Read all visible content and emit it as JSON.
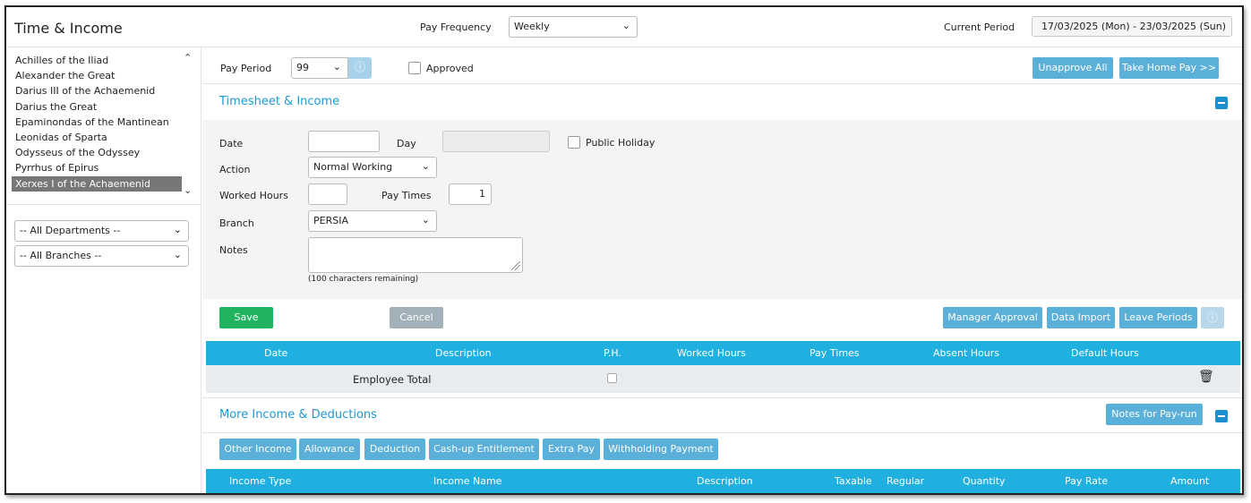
{
  "header": {
    "title": "Time & Income",
    "pay_frequency_label": "Pay Frequency",
    "pay_frequency_value": "Weekly",
    "current_period_label": "Current Period",
    "current_period_value": "17/03/2025 (Mon) - 23/03/2025 (Sun)"
  },
  "sidebar": {
    "employees": [
      "Achilles of the Iliad",
      "Alexander the Great",
      "Darius III of the Achaemenid",
      "Darius the Great",
      "Epaminondas of the Mantinean",
      "Leonidas of Sparta",
      "Odysseus of the Odyssey",
      "Pyrrhus of Epirus",
      "Xerxes I of the Achaemenid"
    ],
    "selected_index": 8,
    "department_filter": "-- All Departments --",
    "branch_filter": "-- All Branches --"
  },
  "payperiod": {
    "label": "Pay Period",
    "value": "99",
    "approved_label": "Approved",
    "unapprove_all": "Unapprove All",
    "take_home_pay": "Take Home Pay >>"
  },
  "timesheet": {
    "title": "Timesheet & Income",
    "date_label": "Date",
    "day_label": "Day",
    "public_holiday_label": "Public Holiday",
    "action_label": "Action",
    "action_value": "Normal Working",
    "worked_hours_label": "Worked Hours",
    "pay_times_label": "Pay Times",
    "pay_times_value": "1",
    "branch_label": "Branch",
    "branch_value": "PERSIA",
    "notes_label": "Notes",
    "notes_remaining": "(100 characters remaining)",
    "save": "Save",
    "cancel": "Cancel",
    "manager_approval": "Manager Approval",
    "data_import": "Data Import",
    "leave_periods": "Leave Periods",
    "columns": [
      "Date",
      "Description",
      "P.H.",
      "Worked Hours",
      "Pay Times",
      "Absent Hours",
      "Default Hours"
    ],
    "total_label": "Employee Total"
  },
  "income": {
    "title": "More Income & Deductions",
    "notes_for_payrun": "Notes for Pay-run",
    "buttons": [
      "Other Income",
      "Allowance",
      "Deduction",
      "Cash-up Entitlement",
      "Extra Pay",
      "Withholding Payment"
    ],
    "columns": [
      "Income Type",
      "Income Name",
      "Description",
      "Taxable",
      "Regular",
      "Quantity",
      "Pay Rate",
      "Amount"
    ]
  },
  "colors": {
    "accent": "#1c9ad6",
    "button_blue": "#5bb0d9",
    "table_header": "#1fb0e0",
    "save_green": "#22b35e"
  },
  "icons": {
    "info": "info-icon",
    "trash": "trash-icon",
    "collapse": "collapse-minus-icon",
    "chevron": "chevron-down-icon"
  }
}
